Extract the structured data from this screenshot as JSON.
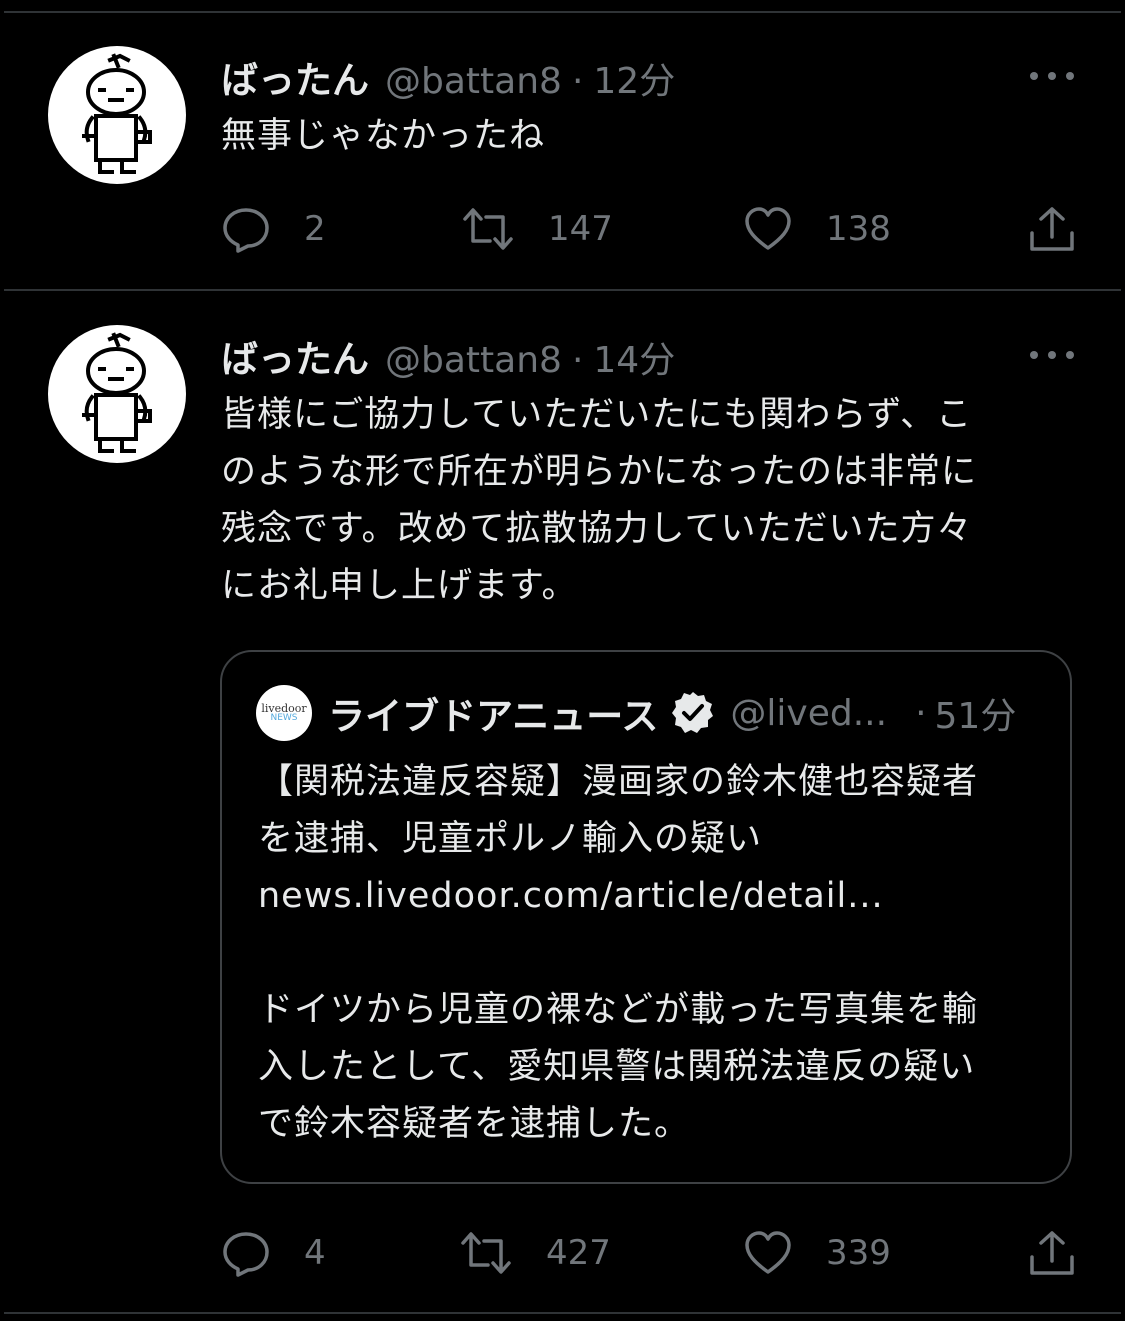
{
  "colors": {
    "background": "#000000",
    "text_primary": "#e7e9ea",
    "text_secondary": "#71767b",
    "divider": "#2f3336"
  },
  "tweets": [
    {
      "author": {
        "name": "ばったん",
        "handle": "@battan8",
        "avatar_icon": "pixel-character-avatar"
      },
      "separator": "·",
      "time": "12分",
      "text": "無事じゃなかったね",
      "actions": {
        "reply_count": "2",
        "retweet_count": "147",
        "like_count": "138"
      }
    },
    {
      "author": {
        "name": "ばったん",
        "handle": "@battan8",
        "avatar_icon": "pixel-character-avatar"
      },
      "separator": "·",
      "time": "14分",
      "text": "皆様にご協力していただいたにも関わらず、こ\nのような形で所在が明らかになったのは非常に\n残念です。改めて拡散協力していただいた方々\nにお礼申し上げます。",
      "quote": {
        "logo_text_top": "livedoor",
        "logo_text_bottom": "NEWS",
        "name": "ライブドアニュース",
        "verified_icon": "verified-badge-icon",
        "handle": "@lived...",
        "separator": "·",
        "time": "51分",
        "text": "【関税法違反容疑】漫画家の鈴木健也容疑者\nを逮捕、児童ポルノ輸入の疑い\nnews.livedoor.com/article/detail...\n\nドイツから児童の裸などが載った写真集を輸\n入したとして、愛知県警は関税法違反の疑い\nで鈴木容疑者を逮捕した。"
      },
      "actions": {
        "reply_count": "4",
        "retweet_count": "427",
        "like_count": "339"
      }
    }
  ]
}
